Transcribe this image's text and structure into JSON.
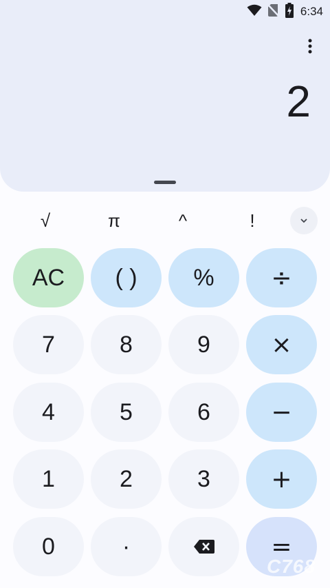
{
  "status_bar": {
    "time": "6:34"
  },
  "display": {
    "result": "2"
  },
  "scientific": {
    "sqrt": "√",
    "pi": "π",
    "power": "^",
    "factorial": "!"
  },
  "keys": {
    "clear": "AC",
    "parens": "( )",
    "percent": "%",
    "divide": "÷",
    "seven": "7",
    "eight": "8",
    "nine": "9",
    "multiply": "×",
    "four": "4",
    "five": "5",
    "six": "6",
    "subtract": "−",
    "one": "1",
    "two": "2",
    "three": "3",
    "add": "+",
    "zero": "0",
    "decimal": "·",
    "equals": "="
  },
  "watermark": {
    "text": "C768"
  },
  "colors": {
    "display_bg": "#e9edf9",
    "operator_key": "#cde6fb",
    "clear_key": "#c6ebcd",
    "number_key": "#f2f4fa",
    "equals_key": "#d6e2fb"
  }
}
